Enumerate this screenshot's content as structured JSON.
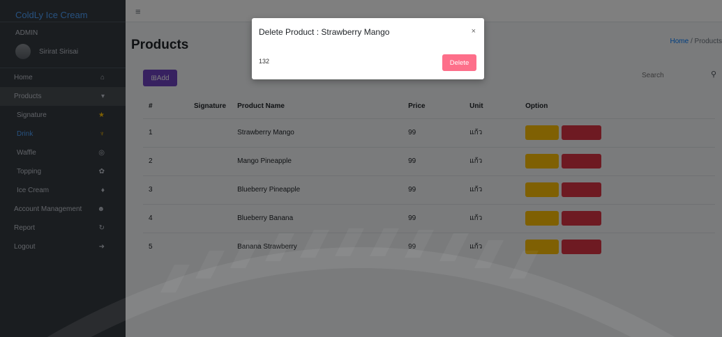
{
  "sidebar": {
    "brand": "ColdLy Ice Cream",
    "role": "ADMIN",
    "user_name": "Sirirat Sirisai",
    "items": [
      {
        "label": "Home",
        "icon": "home-icon"
      },
      {
        "label": "Products",
        "icon": "chevron-down-icon"
      },
      {
        "label": "Signature",
        "icon": "star-icon",
        "color": "#ffc107"
      },
      {
        "label": "Drink",
        "icon": "drink-icon",
        "color": "#ffc107"
      },
      {
        "label": "Waffle",
        "icon": "waffle-icon"
      },
      {
        "label": "Topping",
        "icon": "topping-icon"
      },
      {
        "label": "Ice Cream",
        "icon": "ice-cream-icon"
      },
      {
        "label": "Account Management",
        "icon": "users-icon"
      },
      {
        "label": "Report",
        "icon": "report-icon"
      },
      {
        "label": "Logout",
        "icon": "logout-icon"
      }
    ]
  },
  "page": {
    "title": "Products",
    "breadcrumb_home": "Home",
    "breadcrumb_current": "Products",
    "add_label": "Add",
    "search_placeholder": "Search"
  },
  "table": {
    "headers": [
      "#",
      "Signature",
      "Product Name",
      "Price",
      "Unit",
      "Option"
    ],
    "rows": [
      {
        "num": "1",
        "name": "Strawberry Mango",
        "price": "99",
        "unit": "แก้ว"
      },
      {
        "num": "2",
        "name": "Mango Pineapple",
        "price": "99",
        "unit": "แก้ว"
      },
      {
        "num": "3",
        "name": "Blueberry Pineapple",
        "price": "99",
        "unit": "แก้ว"
      },
      {
        "num": "4",
        "name": "Blueberry Banana",
        "price": "99",
        "unit": "แก้ว"
      },
      {
        "num": "5",
        "name": "Banana Strawberry",
        "price": "99",
        "unit": "แก้ว"
      }
    ]
  },
  "modal": {
    "title": "Delete Product : Strawberry Mango",
    "close_label": "×",
    "product_id": "132",
    "delete_label": "Delete"
  },
  "colors": {
    "sidebar_bg": "#343a40",
    "accent_purple": "#6f42c1",
    "edit_yellow": "#ffc107",
    "delete_red": "#dc3545",
    "modal_delete_pink": "#fd6f8a"
  }
}
